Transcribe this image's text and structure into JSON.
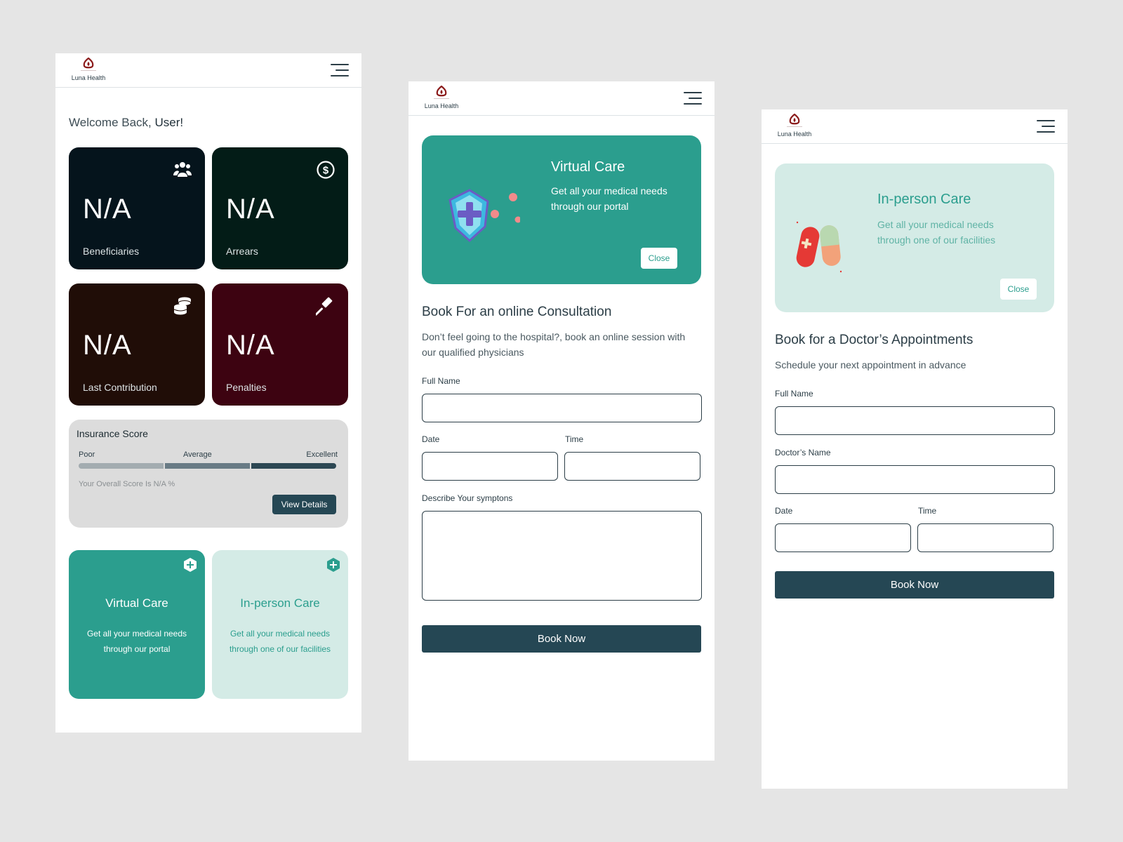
{
  "brand": {
    "name": "Luna Health",
    "logo_color": "#8b1a1a"
  },
  "dashboard": {
    "welcome_prefix": "Welcome Back,",
    "welcome_user": "User!",
    "stats": [
      {
        "value": "N/A",
        "label": "Beneficiaries",
        "icon": "users-icon",
        "color": "#05141c"
      },
      {
        "value": "N/A",
        "label": "Arrears",
        "icon": "dollar-circle-icon",
        "color": "#031c17"
      },
      {
        "value": "N/A",
        "label": "Last Contribution",
        "icon": "coins-stack-icon",
        "color": "#200d07"
      },
      {
        "value": "N/A",
        "label": "Penalties",
        "icon": "gavel-icon",
        "color": "#3d0311"
      }
    ],
    "insurance": {
      "title": "Insurance Score",
      "levels": [
        "Poor",
        "Average",
        "Excellent"
      ],
      "overall": "Your Overall Score Is N/A %",
      "view_label": "View Details"
    },
    "care_cards": [
      {
        "title": "Virtual Care",
        "desc": "Get all your medical needs through our portal",
        "icon": "plus-icon"
      },
      {
        "title": "In-person Care",
        "desc": "Get all your medical needs through one of our facilities",
        "icon": "plus-icon"
      }
    ]
  },
  "virtual": {
    "banner_title": "Virtual Care",
    "banner_desc": "Get all your medical needs through our portal",
    "close_label": "Close",
    "form_title": "Book For an online Consultation",
    "form_desc": "Don’t feel going to the hospital?, book an online session with our qualified physicians",
    "labels": {
      "full_name": "Full Name",
      "date": "Date",
      "time": "Time",
      "symptoms": "Describe Your symptons"
    },
    "values": {
      "full_name": "",
      "date": "",
      "time": "",
      "symptoms": ""
    },
    "book_label": "Book Now"
  },
  "inperson": {
    "banner_title": "In-person Care",
    "banner_desc": "Get all your medical needs through one of our facilities",
    "close_label": "Close",
    "form_title": "Book for a Doctor’s Appointments",
    "form_desc": "Schedule your next appointment in advance",
    "labels": {
      "full_name": "Full Name",
      "doctor": "Doctor’s Name",
      "date": "Date",
      "time": "Time"
    },
    "values": {
      "full_name": "",
      "doctor": "",
      "date": "",
      "time": ""
    },
    "book_label": "Book Now"
  },
  "colors": {
    "accent_teal": "#2b9e8e",
    "light_teal": "#d4ebe6",
    "dark_button": "#254754",
    "score_bar": [
      "#a3acb0",
      "#687b85",
      "#2c4753"
    ]
  }
}
